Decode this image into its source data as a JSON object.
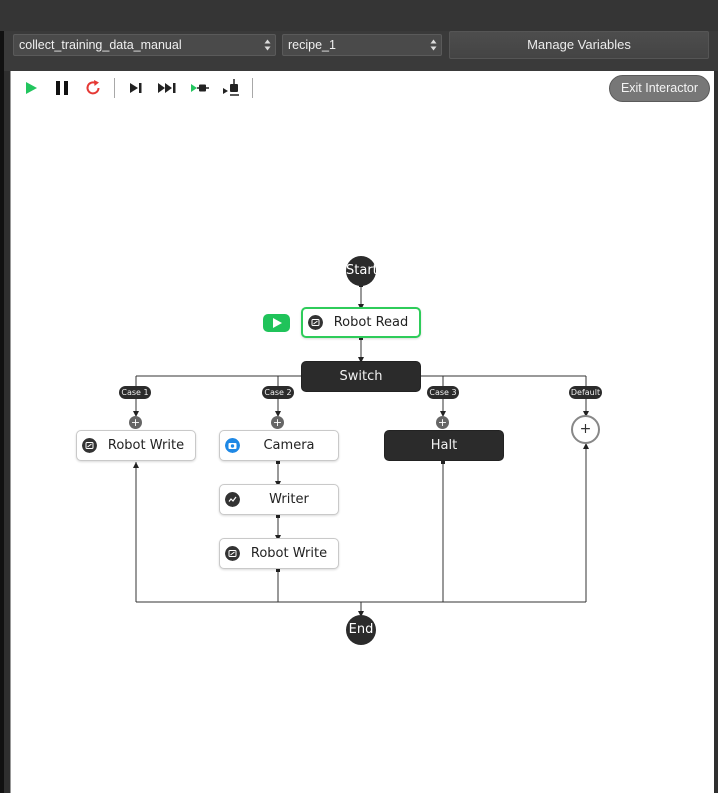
{
  "toolbar": {
    "workflow_select": "collect_training_data_manual",
    "recipe_select": "recipe_1",
    "manage_variables_label": "Manage Variables",
    "exit_interactor_label": "Exit Interactor",
    "controls": [
      "play-icon",
      "pause-icon",
      "restart-icon",
      "step-icon",
      "fast-forward-icon",
      "step-into-icon",
      "step-out-icon"
    ]
  },
  "flow": {
    "start_label": "Start",
    "end_label": "End",
    "robot_read_label": "Robot Read",
    "switch_label": "Switch",
    "cases": [
      "Case 1",
      "Case 2",
      "Case 3",
      "Default"
    ],
    "robot_write_1_label": "Robot Write",
    "camera_label": "Camera",
    "writer_label": "Writer",
    "robot_write_2_label": "Robot Write",
    "halt_label": "Halt",
    "add_symbol": "+"
  },
  "colors": {
    "active_green": "#2ecc5a",
    "node_dark": "#2b2b2b",
    "camera_blue": "#1e88e5",
    "restart_red": "#e53935"
  }
}
